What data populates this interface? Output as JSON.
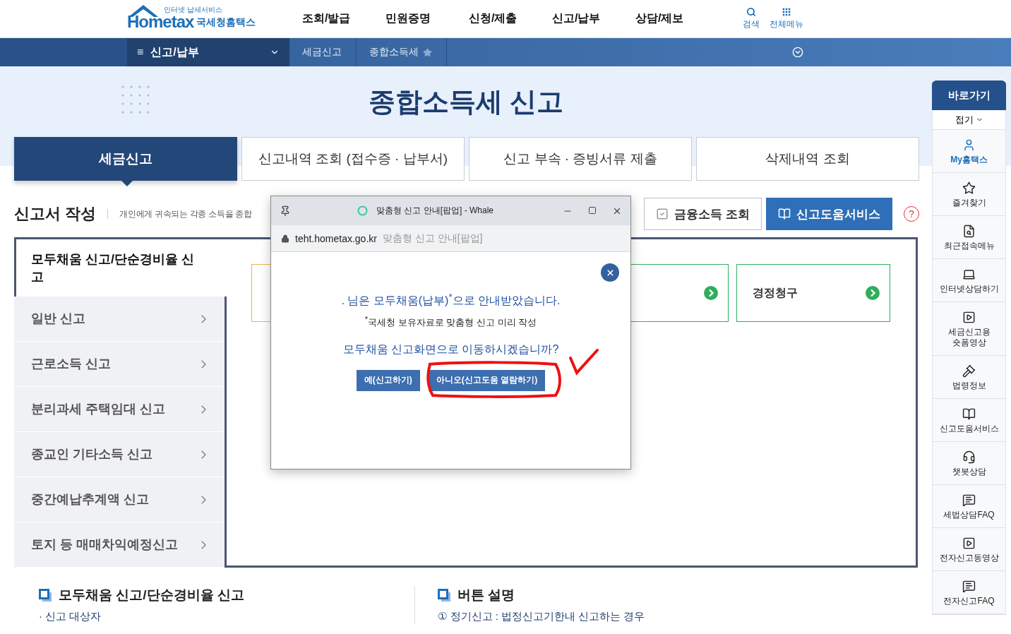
{
  "header": {
    "logo": {
      "tagline": "인터넷 납세서비스",
      "brand": "Hometax",
      "name": "국세청홈택스"
    },
    "nav": [
      "조회/발급",
      "민원증명",
      "신청/제출",
      "신고/납부",
      "상담/제보"
    ],
    "tools": [
      {
        "kind": "search",
        "label": "검색"
      },
      {
        "kind": "menu",
        "label": "전체메뉴"
      }
    ]
  },
  "menubar": {
    "menu_glyph": "≡",
    "menu": "신고/납부",
    "breadcrumbs": [
      {
        "label": "세금신고",
        "starred": false
      },
      {
        "label": "종합소득세",
        "starred": true
      }
    ]
  },
  "hero": {
    "title": "종합소득세 신고"
  },
  "tabs": [
    {
      "label": "세금신고",
      "selected": true
    },
    {
      "label": "신고내역 조회 (접수증 · 납부서)",
      "selected": false
    },
    {
      "label": "신고 부속 · 증빙서류 제출",
      "selected": false
    },
    {
      "label": "삭제내역 조회",
      "selected": false
    }
  ],
  "section": {
    "title": "신고서 작성",
    "description": "개인에게 귀속되는 각종 소득을 종합",
    "buttons": [
      {
        "kind": "outline",
        "label": "금융소득 조회"
      },
      {
        "kind": "primary",
        "label": "신고도움서비스"
      }
    ],
    "help": "?"
  },
  "menu": [
    {
      "label": "모두채움 신고/단순경비율 신고",
      "selected": true
    },
    {
      "label": "일반 신고",
      "selected": false
    },
    {
      "label": "근로소득 신고",
      "selected": false
    },
    {
      "label": "분리과세 주택임대 신고",
      "selected": false
    },
    {
      "label": "종교인 기타소득 신고",
      "selected": false
    },
    {
      "label": "중간예납추계액 신고",
      "selected": false
    },
    {
      "label": "토지 등 매매차익예정신고",
      "selected": false
    }
  ],
  "cards": [
    {
      "color": "#e8b54e"
    },
    {
      "color": "#2fae5c",
      "arrow": true
    },
    {
      "label": "경정청구",
      "color": "#2fae5c",
      "arrow": true
    }
  ],
  "popup": {
    "title": "맞춤형 신고 안내[팝업] - Whale",
    "url": "teht.hometax.go.kr",
    "page_title": "맞춤형 신고 안내[팝업]",
    "message": ".  님은 모두채움(납부)$^{*}$으로 안내받았습니다.",
    "note": "$^{*}$국세청 보유자료로 맞춤형 신고 미리 작성",
    "question": "모두채움 신고화면으로 이동하시겠습니까?",
    "buttons": [
      {
        "label": "예(신고하기)",
        "annotated": false
      },
      {
        "label": "아니오(신고도움 열람하기)",
        "annotated": true
      }
    ]
  },
  "info": [
    {
      "title": "모두채움 신고/단순경비율 신고",
      "line": "· 신고 대상자"
    },
    {
      "title": "버튼 설명",
      "line": "① 정기신고 : 법정신고기한내 신고하는 경우"
    }
  ],
  "quick_menu": {
    "title": "바로가기",
    "toggle": "접기",
    "items": [
      {
        "label": "My홈택스",
        "selected": true
      },
      {
        "label": "즐겨찾기",
        "selected": false
      },
      {
        "label": "최근접속메뉴",
        "selected": false
      },
      {
        "label": "인터넷상담하기",
        "selected": false
      },
      {
        "label": "세금신고용\n숏폼영상",
        "selected": false
      },
      {
        "label": "법령정보",
        "selected": false
      },
      {
        "label": "신고도움서비스",
        "selected": false
      },
      {
        "label": "챗봇상담",
        "selected": false
      },
      {
        "label": "세법상담FAQ",
        "selected": false
      },
      {
        "label": "전자신고동영상",
        "selected": false
      },
      {
        "label": "전자신고FAQ",
        "selected": false
      }
    ]
  }
}
